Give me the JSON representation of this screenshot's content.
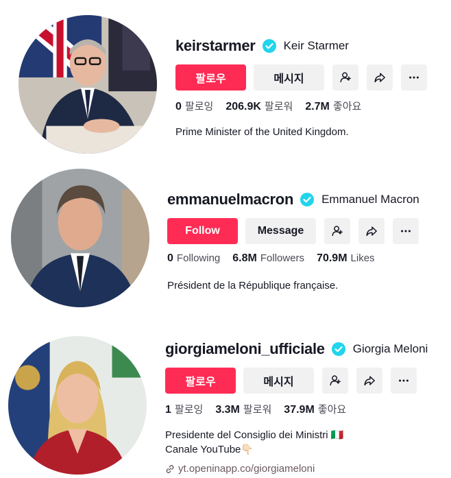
{
  "profiles": [
    {
      "username": "keirstarmer",
      "display_name": "Keir Starmer",
      "follow_label": "팔로우",
      "message_label": "메시지",
      "stats": [
        {
          "value": "0",
          "label": "팔로잉"
        },
        {
          "value": "206.9K",
          "label": "팔로워"
        },
        {
          "value": "2.7M",
          "label": "좋아요"
        }
      ],
      "bio": [
        "Prime Minister of the United Kingdom."
      ]
    },
    {
      "username": "emmanuelmacron",
      "display_name": "Emmanuel Macron",
      "follow_label": "Follow",
      "message_label": "Message",
      "stats": [
        {
          "value": "0",
          "label": "Following"
        },
        {
          "value": "6.8M",
          "label": "Followers"
        },
        {
          "value": "70.9M",
          "label": "Likes"
        }
      ],
      "bio": [
        "Président de la République française."
      ]
    },
    {
      "username": "giorgiameloni_ufficiale",
      "display_name": "Giorgia Meloni",
      "follow_label": "팔로우",
      "message_label": "메시지",
      "stats": [
        {
          "value": "1",
          "label": "팔로잉"
        },
        {
          "value": "3.3M",
          "label": "팔로워"
        },
        {
          "value": "37.9M",
          "label": "좋아요"
        }
      ],
      "bio": [
        "Presidente del Consiglio dei Ministri 🇮🇹",
        "Canale YouTube👇🏻"
      ],
      "link": "yt.openinapp.co/giorgiameloni"
    }
  ],
  "colors": {
    "accent": "#fe2c55",
    "verified": "#20d5ec",
    "secondary_button": "#f1f1f2"
  },
  "icons": [
    "verified-badge-icon",
    "add-friend-icon",
    "share-icon",
    "more-icon",
    "link-icon"
  ]
}
